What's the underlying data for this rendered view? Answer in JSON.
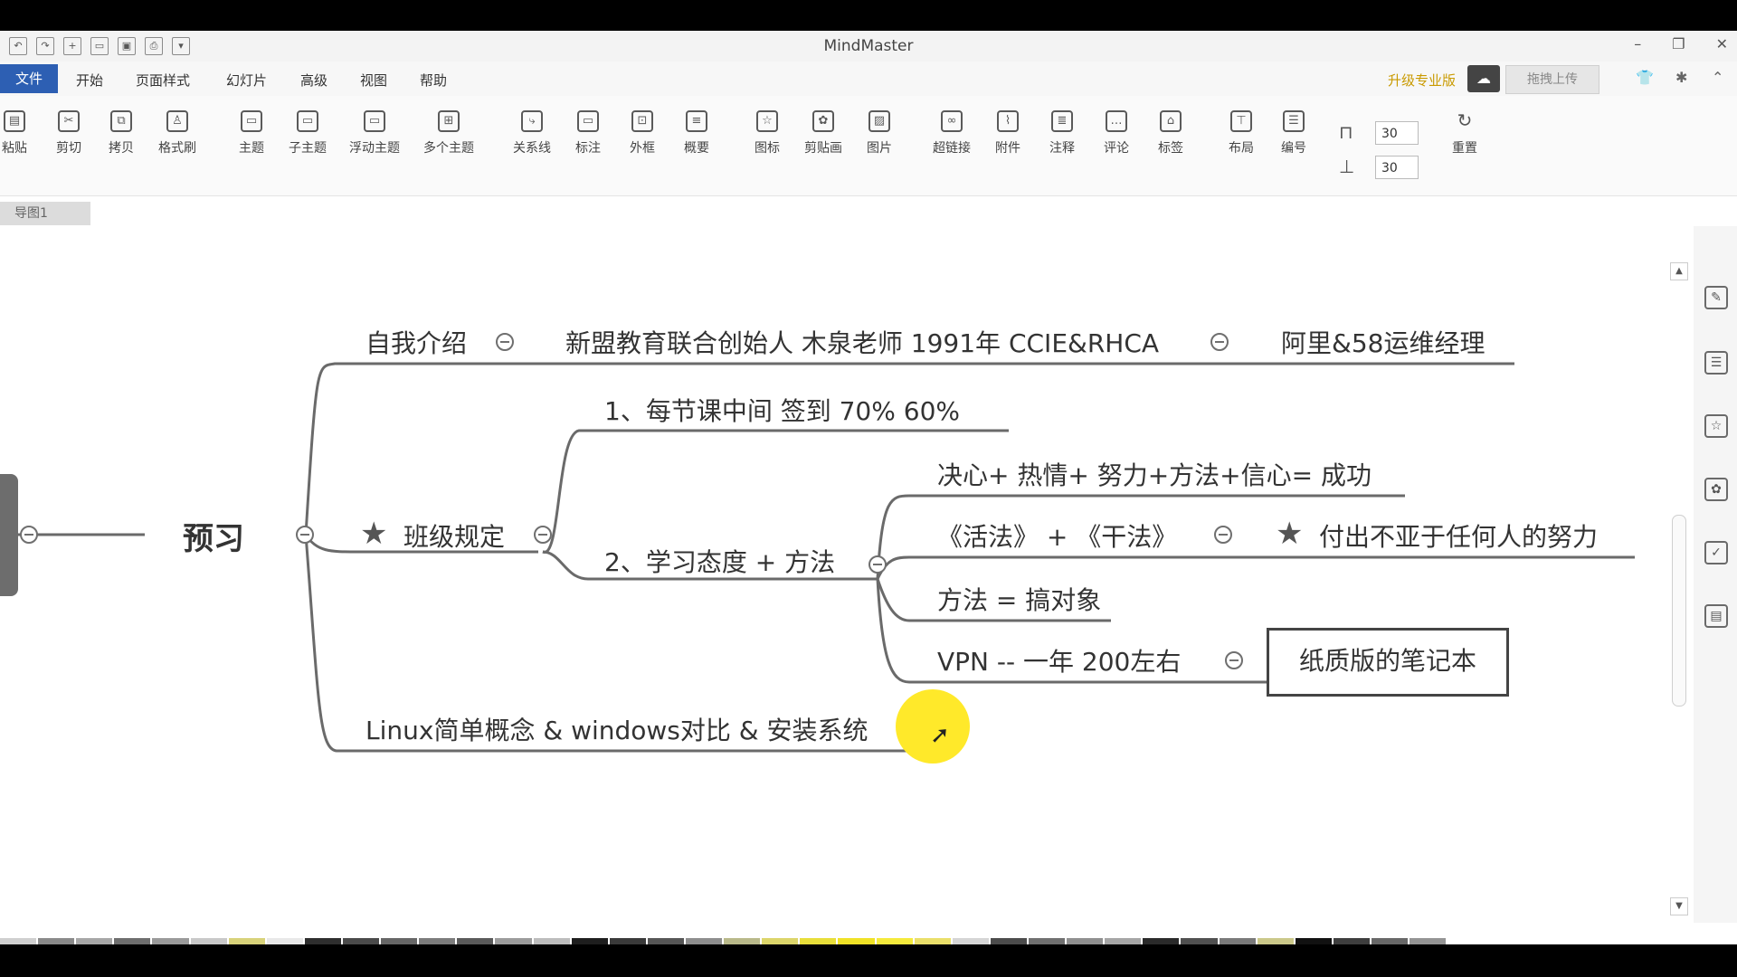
{
  "app": {
    "title": "MindMaster"
  },
  "menu": {
    "file": "文件",
    "items": [
      "开始",
      "页面样式",
      "幻灯片",
      "高级",
      "视图",
      "帮助"
    ],
    "upgrade": "升级专业版",
    "upload": "拖拽上传"
  },
  "ribbon": {
    "tools": [
      "粘贴",
      "剪切",
      "拷贝",
      "格式刷",
      "主题",
      "子主题",
      "浮动主题",
      "多个主题",
      "关系线",
      "标注",
      "外框",
      "概要",
      "图标",
      "剪贴画",
      "图片",
      "超链接",
      "附件",
      "注释",
      "评论",
      "标签",
      "布局",
      "编号"
    ],
    "spacing_h": "30",
    "spacing_v": "30",
    "reset": "重置"
  },
  "doc_tab": "导图1",
  "mindmap": {
    "central": "预习",
    "intro": "自我介绍",
    "intro_detail1": "新盟教育联合创始人 木泉老师 1991年 CCIE&RHCA",
    "intro_detail2": "阿里&58运维经理",
    "class_rules": "班级规定",
    "rule1": "1、每节课中间 签到  70%  60%",
    "rule2": "2、学习态度 + 方法",
    "formula": "决心+ 热情+ 努力+方法+信心= 成功",
    "books": "《活法》 + 《干法》",
    "effort": "付出不亚于任何人的努力",
    "method": "方法 = 搞对象",
    "vpn": "VPN -- 一年 200左右",
    "notebook": "纸质版的笔记本",
    "linux": "Linux简单概念 & windows对比 & 安装系统"
  },
  "colors": {
    "accent": "#2d5fb3",
    "highlight": "#ffe92a",
    "line": "#6a6a6a"
  }
}
